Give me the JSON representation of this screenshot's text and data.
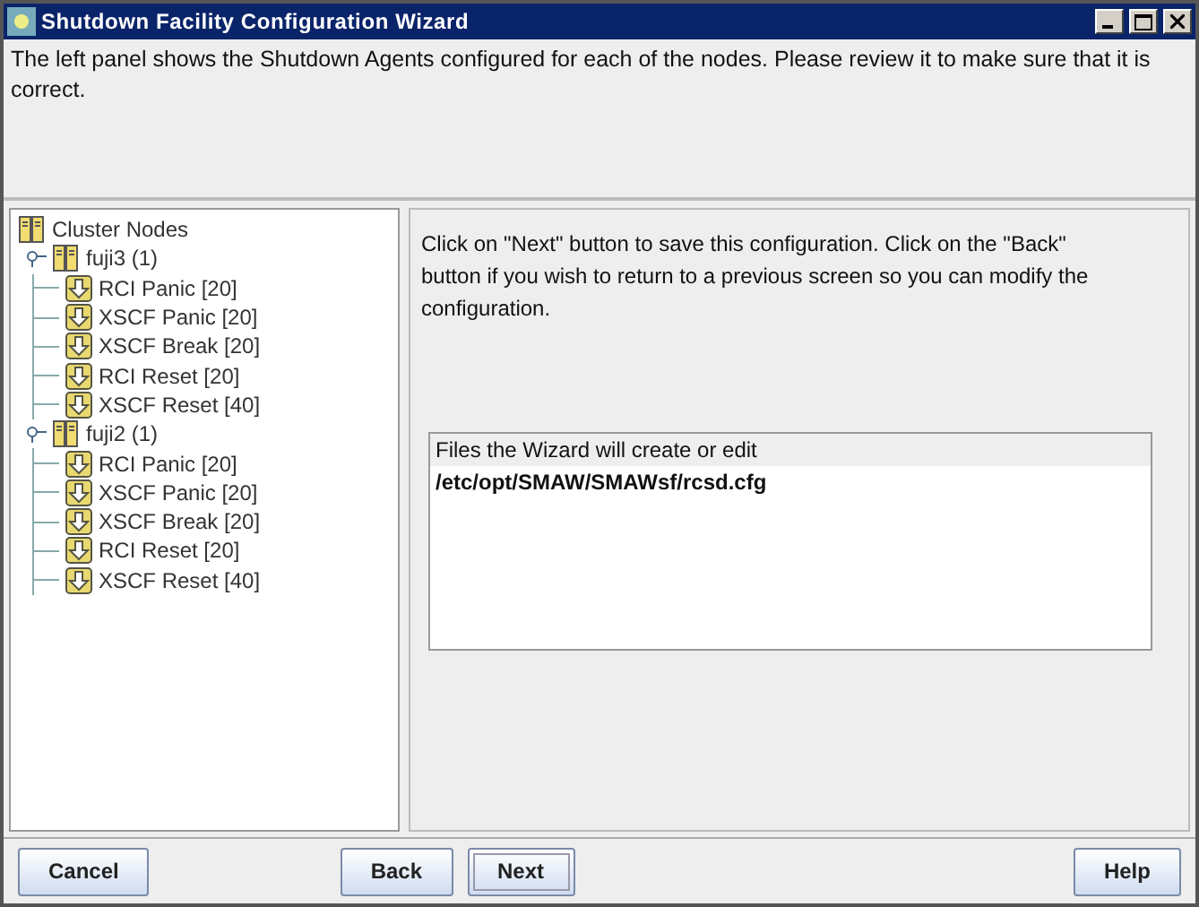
{
  "window": {
    "title": "Shutdown Facility Configuration Wizard"
  },
  "intro": "The left panel shows the Shutdown Agents configured for each of the nodes. Please review it to make sure that it is correct.",
  "tree": {
    "label": "Cluster Nodes",
    "children": [
      {
        "label": "fuji3 (1)",
        "expanded": true,
        "children": [
          {
            "label": "RCI Panic [20]"
          },
          {
            "label": "XSCF Panic [20]"
          },
          {
            "label": "XSCF Break [20]"
          },
          {
            "label": "RCI Reset [20]"
          },
          {
            "label": "XSCF Reset [40]"
          }
        ]
      },
      {
        "label": "fuji2 (1)",
        "expanded": true,
        "children": [
          {
            "label": "RCI Panic [20]"
          },
          {
            "label": "XSCF Panic [20]"
          },
          {
            "label": "XSCF Break [20]"
          },
          {
            "label": "RCI Reset [20]"
          },
          {
            "label": "XSCF Reset [40]"
          }
        ]
      }
    ]
  },
  "instructions": "Click on \"Next\" button to save this configuration. Click on the \"Back\" button if you wish to return to a previous screen so you can modify the configuration.",
  "files": {
    "header": "Files the Wizard will create or edit",
    "items": [
      "/etc/opt/SMAW/SMAWsf/rcsd.cfg"
    ]
  },
  "buttons": [
    {
      "label": "Cancel",
      "focused": false
    },
    {
      "label": "Back",
      "focused": false
    },
    {
      "label": "Next",
      "focused": true
    },
    {
      "label": "Help",
      "focused": false
    }
  ]
}
